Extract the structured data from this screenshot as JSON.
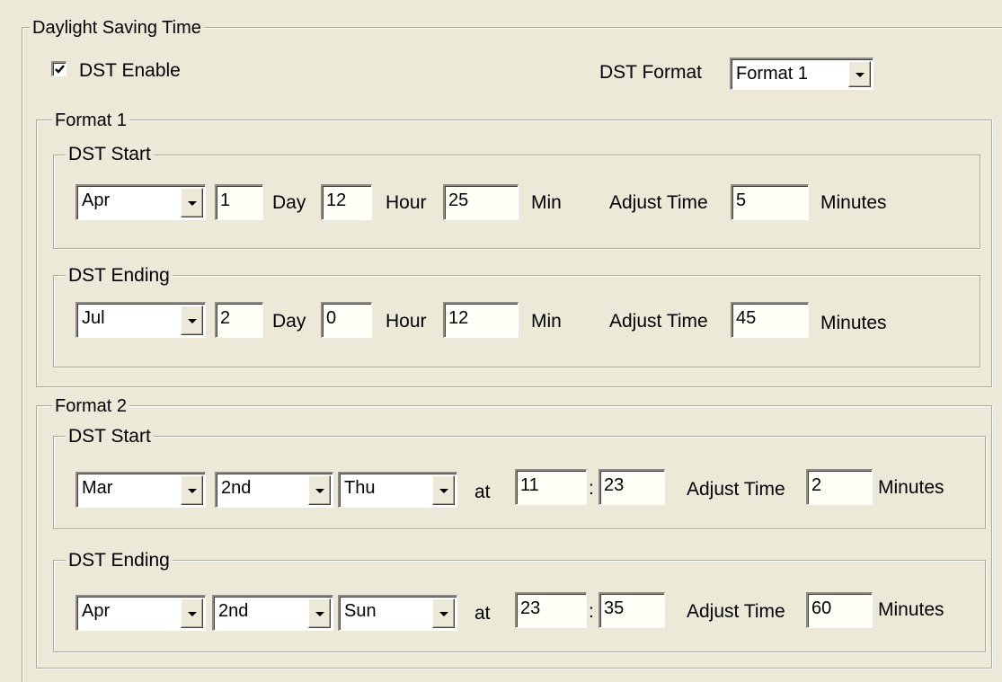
{
  "dst_group": {
    "title": "Daylight Saving Time",
    "enable_label": "DST Enable",
    "enable_checked": true,
    "format_label": "DST Format",
    "format_value": "Format 1"
  },
  "format1": {
    "title": "Format 1",
    "start": {
      "title": "DST Start",
      "month": "Apr",
      "day": "1",
      "day_label": "Day",
      "hour": "12",
      "hour_label": "Hour",
      "min": "25",
      "min_label": "Min",
      "adjust_label": "Adjust Time",
      "adjust": "5",
      "minutes_label": "Minutes"
    },
    "end": {
      "title": "DST Ending",
      "month": "Jul",
      "day": "2",
      "day_label": "Day",
      "hour": "0",
      "hour_label": "Hour",
      "min": "12",
      "min_label": "Min",
      "adjust_label": "Adjust Time",
      "adjust": "45",
      "minutes_label": "Minutes"
    }
  },
  "format2": {
    "title": "Format 2",
    "start": {
      "title": "DST Start",
      "month": "Mar",
      "week": "2nd",
      "weekday": "Thu",
      "at_label": "at",
      "hour": "11",
      "colon": ":",
      "minute": "23",
      "adjust_label": "Adjust Time",
      "adjust": "2",
      "minutes_label": "Minutes"
    },
    "end": {
      "title": "DST Ending",
      "month": "Apr",
      "week": "2nd",
      "weekday": "Sun",
      "at_label": "at",
      "hour": "23",
      "colon": ":",
      "minute": "35",
      "adjust_label": "Adjust Time",
      "adjust": "60",
      "minutes_label": "Minutes"
    }
  },
  "colors": {
    "background": "#ece9d8",
    "field_background": "#fffff8",
    "group_border": "#aca899"
  },
  "icons": {
    "checkbox_mark": "check-icon",
    "combo_arrow": "chevron-down-icon"
  }
}
